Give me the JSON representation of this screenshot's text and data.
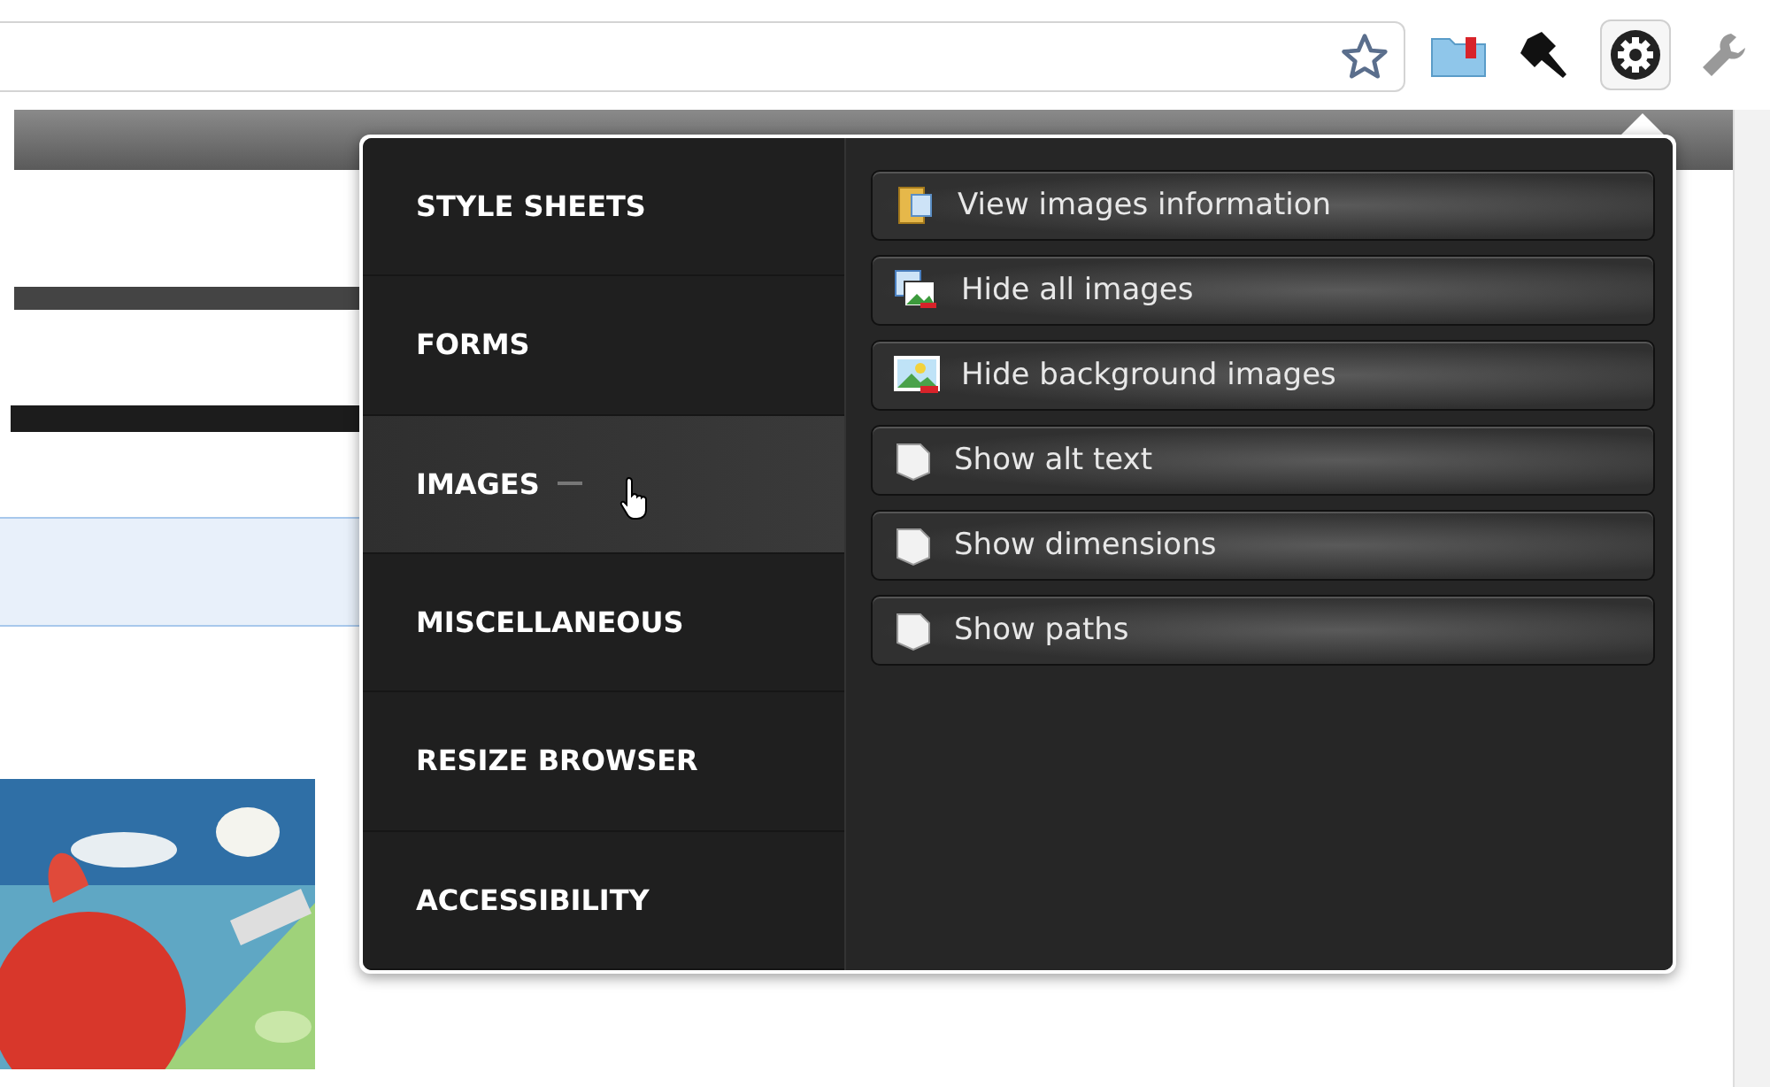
{
  "toolbar": {
    "extensions": [
      {
        "kind": "bookmark-folder",
        "selected": false
      },
      {
        "kind": "pin",
        "selected": false
      },
      {
        "kind": "gear",
        "selected": true
      },
      {
        "kind": "wrench",
        "selected": false
      }
    ]
  },
  "popup": {
    "categories": [
      {
        "label": "STYLE SHEETS",
        "selected": false
      },
      {
        "label": "FORMS",
        "selected": false
      },
      {
        "label": "IMAGES",
        "selected": true
      },
      {
        "label": "MISCELLANEOUS",
        "selected": false
      },
      {
        "label": "RESIZE BROWSER",
        "selected": false
      },
      {
        "label": "ACCESSIBILITY",
        "selected": false
      }
    ],
    "actions": [
      {
        "label": "View images information",
        "kind": "info"
      },
      {
        "label": "Hide all images",
        "kind": "hide-all"
      },
      {
        "label": "Hide background images",
        "kind": "hide-background"
      },
      {
        "label": "Show alt text",
        "kind": "note"
      },
      {
        "label": "Show dimensions",
        "kind": "note"
      },
      {
        "label": "Show paths",
        "kind": "note"
      }
    ]
  }
}
